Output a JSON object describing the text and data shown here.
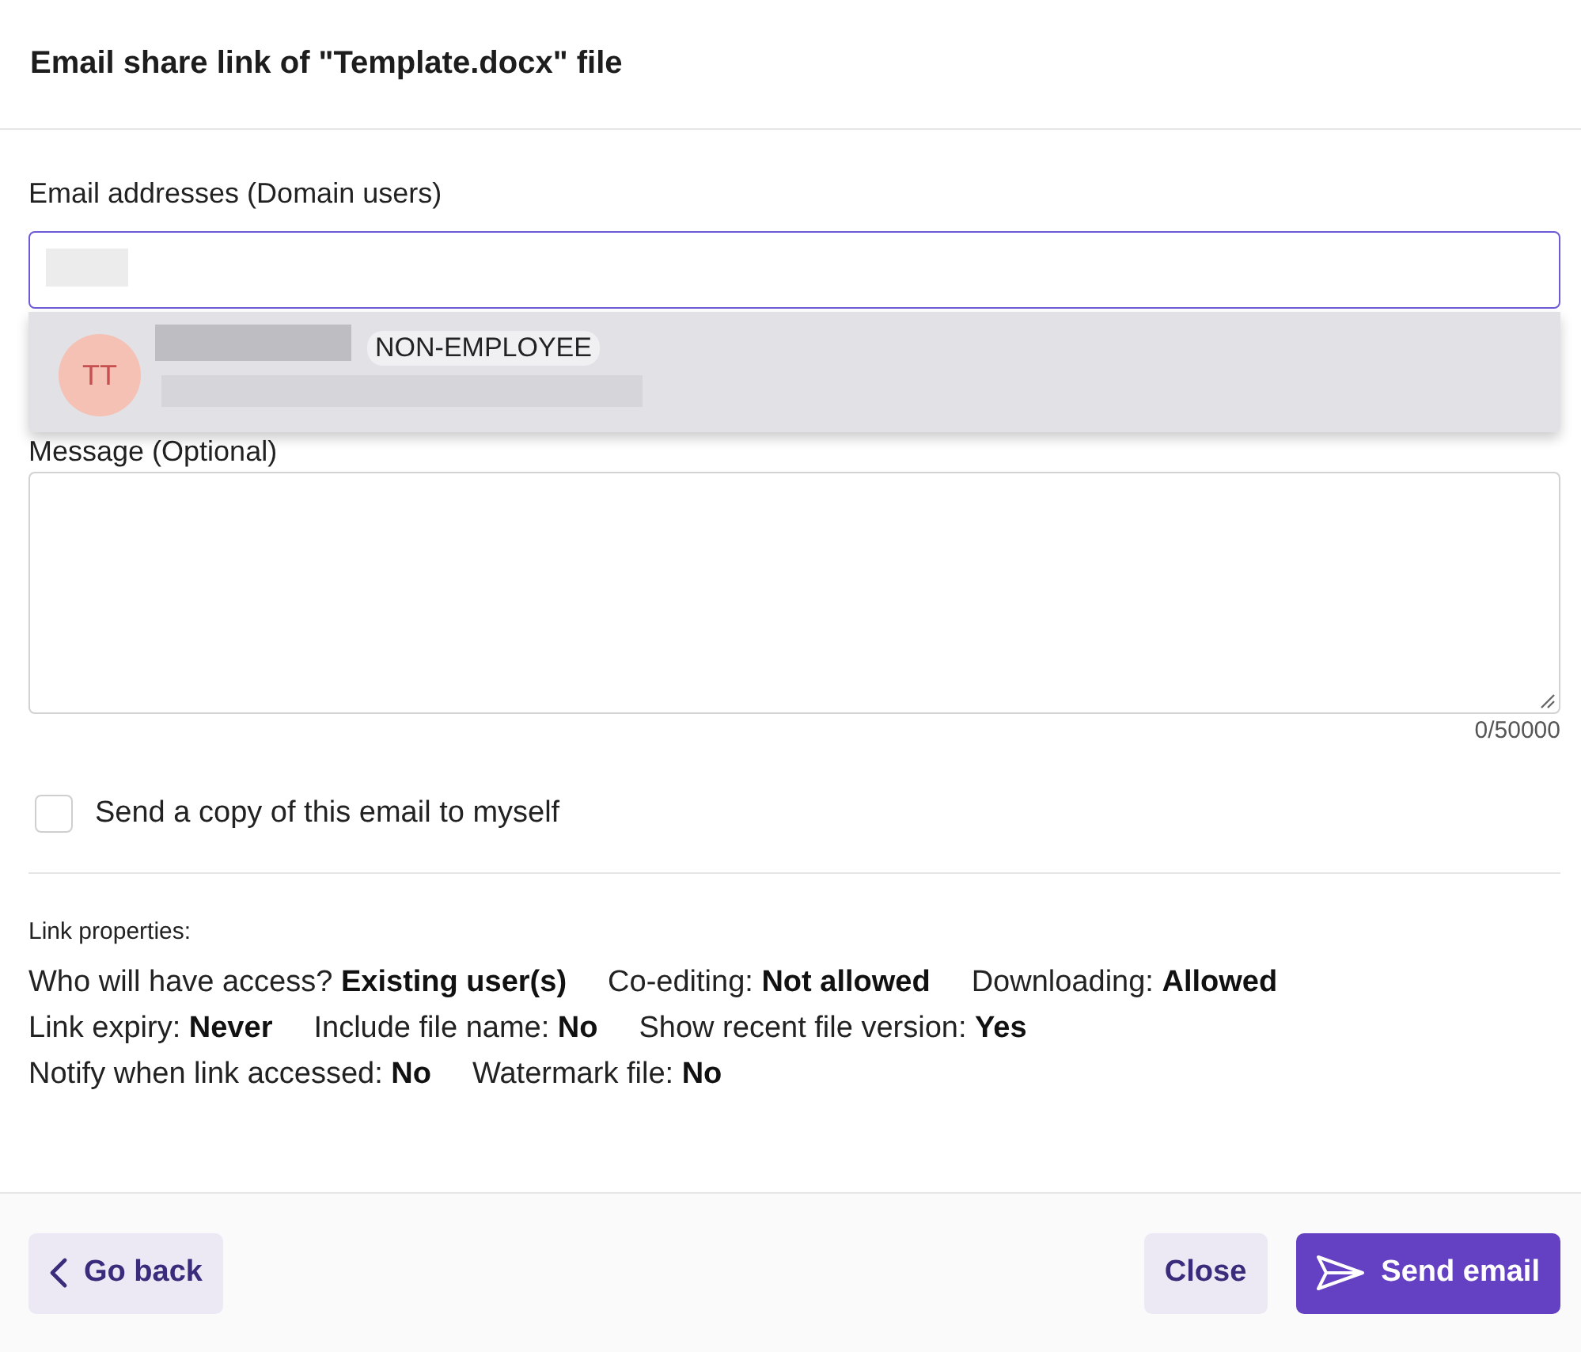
{
  "dialog": {
    "title": "Email share link of \"Template.docx\" file"
  },
  "email_field": {
    "label": "Email addresses (Domain users)"
  },
  "suggestion": {
    "initials": "TT",
    "badge": "NON-EMPLOYEE"
  },
  "message_field": {
    "label": "Message (Optional)",
    "counter": "0/50000"
  },
  "copy_to_self": {
    "label": "Send a copy of this email to myself",
    "checked": false
  },
  "link_properties": {
    "heading": "Link properties:",
    "rows": [
      [
        {
          "label": "Who will have access?",
          "value": "Existing user(s)"
        },
        {
          "label": "Co-editing:",
          "value": "Not allowed"
        },
        {
          "label": "Downloading:",
          "value": "Allowed"
        }
      ],
      [
        {
          "label": "Link expiry:",
          "value": "Never"
        },
        {
          "label": "Include file name:",
          "value": "No"
        },
        {
          "label": "Show recent file version:",
          "value": "Yes"
        }
      ],
      [
        {
          "label": "Notify when link accessed:",
          "value": "No"
        },
        {
          "label": "Watermark file:",
          "value": "No"
        }
      ]
    ]
  },
  "footer": {
    "back": "Go back",
    "close": "Close",
    "send": "Send email"
  }
}
